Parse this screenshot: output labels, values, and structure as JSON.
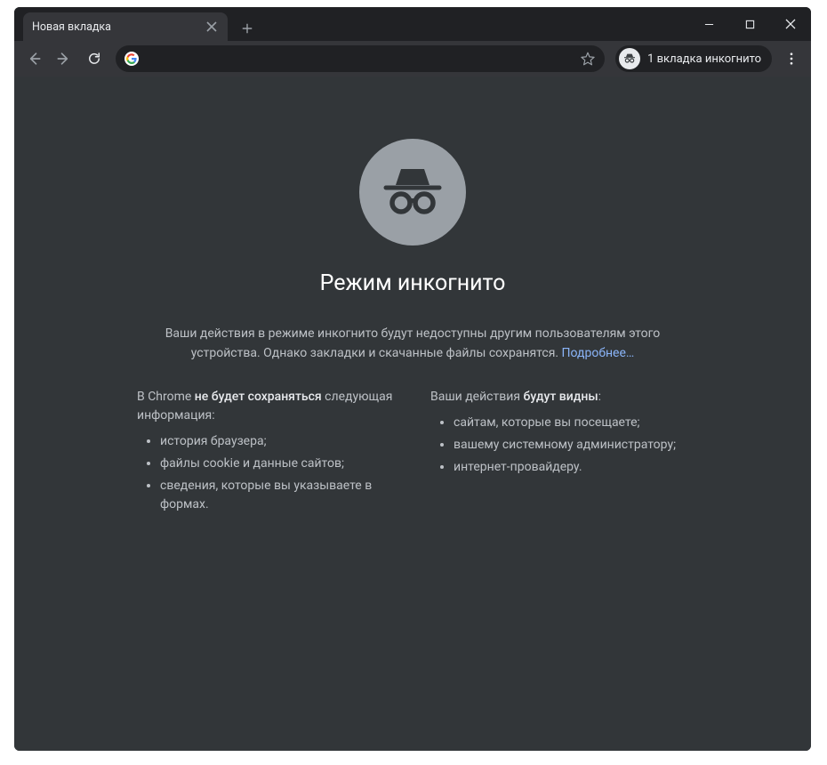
{
  "tab": {
    "title": "Новая вкладка"
  },
  "toolbar": {
    "incognito_chip": "1 вкладка инкогнито",
    "address_value": ""
  },
  "page": {
    "title": "Режим инкогнито",
    "intro_1": "Ваши действия в режиме инкогнито будут недоступны другим пользователям этого устройства. Однако закладки и скачанные файлы сохранятся. ",
    "learn_more": "Подробнее…",
    "left_head_prefix": "В Chrome ",
    "left_head_strong": "не будет сохраняться",
    "left_head_suffix": " следующая информация:",
    "left_items": [
      "история браузера;",
      "файлы cookie и данные сайтов;",
      "сведения, которые вы указываете в формах."
    ],
    "right_head_prefix": "Ваши действия ",
    "right_head_strong": "будут видны",
    "right_head_suffix": ":",
    "right_items": [
      "сайтам, которые вы посещаете;",
      "вашему системному администратору;",
      "интернет-провайдеру."
    ]
  }
}
